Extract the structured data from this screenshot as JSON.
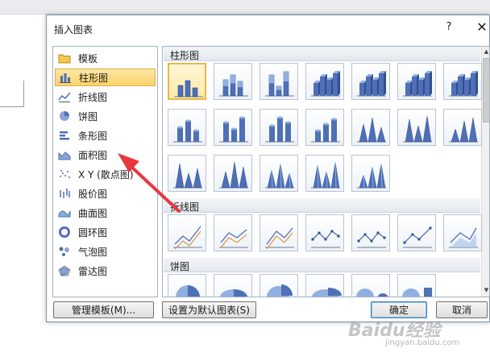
{
  "dialog": {
    "title": "插入图表",
    "help_label": "?",
    "close_label": "✕"
  },
  "categories": [
    {
      "label": "模板",
      "icon": "folder-icon"
    },
    {
      "label": "柱形图",
      "icon": "column-chart-icon",
      "selected": true
    },
    {
      "label": "折线图",
      "icon": "line-chart-icon"
    },
    {
      "label": "饼图",
      "icon": "pie-chart-icon"
    },
    {
      "label": "条形图",
      "icon": "bar-chart-icon"
    },
    {
      "label": "面积图",
      "icon": "area-chart-icon"
    },
    {
      "label": "X Y (散点图)",
      "icon": "scatter-chart-icon"
    },
    {
      "label": "股价图",
      "icon": "stock-chart-icon"
    },
    {
      "label": "曲面图",
      "icon": "surface-chart-icon"
    },
    {
      "label": "圆环图",
      "icon": "doughnut-chart-icon"
    },
    {
      "label": "气泡图",
      "icon": "bubble-chart-icon"
    },
    {
      "label": "雷达图",
      "icon": "radar-chart-icon"
    }
  ],
  "gallery": {
    "sections": [
      {
        "label": "柱形图"
      },
      {
        "label": "折线图"
      },
      {
        "label": "饼图"
      }
    ]
  },
  "buttons": {
    "manage_templates": "管理模板(M)...",
    "set_default": "设置为默认图表(S)",
    "ok": "确定",
    "cancel": "取消"
  },
  "watermark": {
    "brand": "Baidu经验",
    "url": "jingyan.baidu.com"
  },
  "colors": {
    "accent_selected": "#fbd36a",
    "annotation_arrow": "#e8383d",
    "chart_blue": "#4f6fb7"
  }
}
